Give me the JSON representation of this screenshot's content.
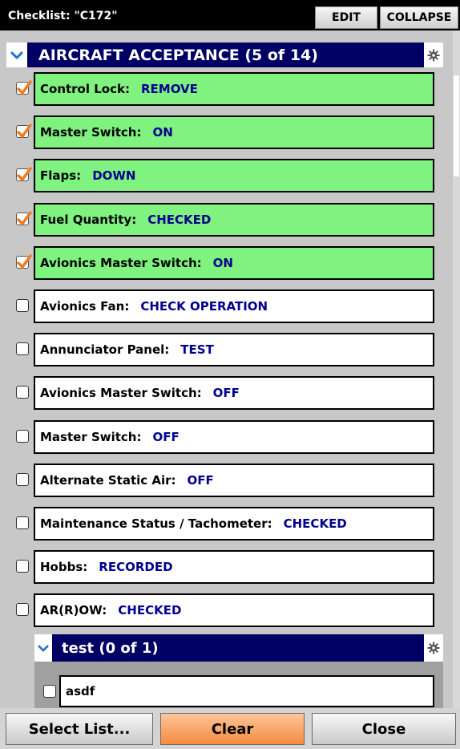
{
  "header": {
    "title": "Checklist: \"C172\"",
    "edit_label": "EDIT",
    "collapse_label": "COLLAPSE"
  },
  "section": {
    "title": "AIRCRAFT ACCEPTANCE (5 of 14)",
    "expand_icon": "chevron-down-icon",
    "settings_icon": "gear-icon"
  },
  "items": [
    {
      "label": "Control Lock:",
      "value": "REMOVE",
      "checked": true
    },
    {
      "label": "Master Switch:",
      "value": "ON",
      "checked": true
    },
    {
      "label": "Flaps:",
      "value": "DOWN",
      "checked": true
    },
    {
      "label": "Fuel Quantity:",
      "value": "CHECKED",
      "checked": true
    },
    {
      "label": "Avionics Master Switch:",
      "value": "ON",
      "checked": true
    },
    {
      "label": "Avionics Fan:",
      "value": "CHECK OPERATION",
      "checked": false
    },
    {
      "label": "Annunciator Panel:",
      "value": "TEST",
      "checked": false
    },
    {
      "label": "Avionics Master Switch:",
      "value": "OFF",
      "checked": false
    },
    {
      "label": "Master Switch:",
      "value": "OFF",
      "checked": false
    },
    {
      "label": "Alternate Static Air:",
      "value": "OFF",
      "checked": false
    },
    {
      "label": "Maintenance Status / Tachometer:",
      "value": "CHECKED",
      "checked": false
    },
    {
      "label": "Hobbs:",
      "value": "RECORDED",
      "checked": false
    },
    {
      "label": "AR(R)OW:",
      "value": "CHECKED",
      "checked": false
    }
  ],
  "subsection": {
    "title": "test (0 of 1)",
    "items": [
      {
        "label": "asdf",
        "checked": false
      }
    ]
  },
  "footer": {
    "select_list_label": "Select List...",
    "clear_label": "Clear",
    "close_label": "Close"
  },
  "colors": {
    "done_bg": "#7ff27f",
    "value_text": "#00008c",
    "section_bg": "#000064",
    "check_orange": "#f07a1e",
    "clear_button": "#f48a3e"
  }
}
